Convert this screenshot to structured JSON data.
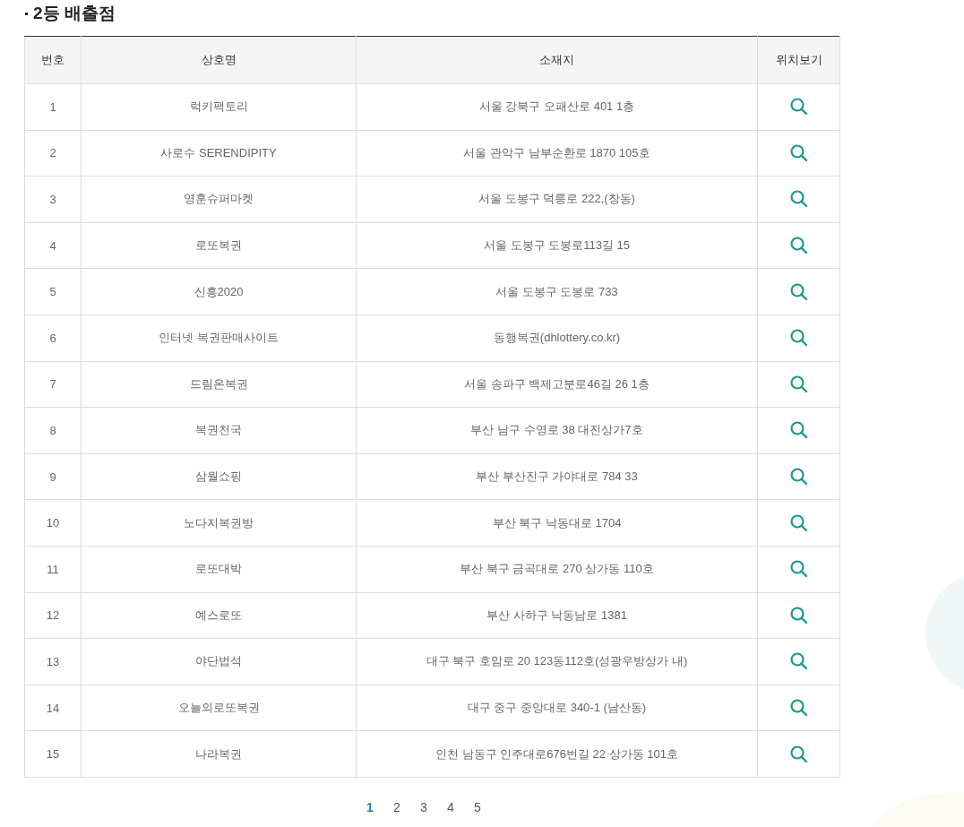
{
  "title": "2등 배출점",
  "table": {
    "columns": [
      "번호",
      "상호명",
      "소재지",
      "위치보기"
    ],
    "rows": [
      {
        "no": "1",
        "name": "럭키팩토리",
        "address": "서울 강북구 오패산로 401 1층"
      },
      {
        "no": "2",
        "name": "사로수 SERENDIPITY",
        "address": "서울 관악구 남부순환로 1870 105호"
      },
      {
        "no": "3",
        "name": "영훈슈퍼마켓",
        "address": "서울 도봉구 덕릉로 222,(창동)"
      },
      {
        "no": "4",
        "name": "로또복권",
        "address": "서울 도봉구 도봉로113길 15"
      },
      {
        "no": "5",
        "name": "신흥2020",
        "address": "서울 도봉구 도봉로 733"
      },
      {
        "no": "6",
        "name": "인터넷 복권판매사이트",
        "address": "동행복권(dhlottery.co.kr)"
      },
      {
        "no": "7",
        "name": "드림온복권",
        "address": "서울 송파구 백제고분로46길 26 1층"
      },
      {
        "no": "8",
        "name": "복권천국",
        "address": "부산 남구 수영로 38 대진상가7호"
      },
      {
        "no": "9",
        "name": "삼월쇼핑",
        "address": "부산 부산진구 가야대로 784 33"
      },
      {
        "no": "10",
        "name": "노다지복권방",
        "address": "부산 북구 낙동대로 1704"
      },
      {
        "no": "11",
        "name": "로또대박",
        "address": "부산 북구 금곡대로 270 상가동 110호"
      },
      {
        "no": "12",
        "name": "예스로또",
        "address": "부산 사하구 낙동남로 1381"
      },
      {
        "no": "13",
        "name": "야단법석",
        "address": "대구 북구 호암로 20 123동112호(성광우방상가 내)"
      },
      {
        "no": "14",
        "name": "오늘의로또복권",
        "address": "대구 중구 중앙대로 340-1 (남산동)"
      },
      {
        "no": "15",
        "name": "나라복권",
        "address": "인천 남동구 인주대로676번길 22 상가동 101호"
      }
    ]
  },
  "pagination": [
    {
      "label": "1",
      "selected": true
    },
    {
      "label": "2",
      "selected": false
    },
    {
      "label": "3",
      "selected": false
    },
    {
      "label": "4",
      "selected": false
    },
    {
      "label": "5",
      "selected": false
    }
  ]
}
